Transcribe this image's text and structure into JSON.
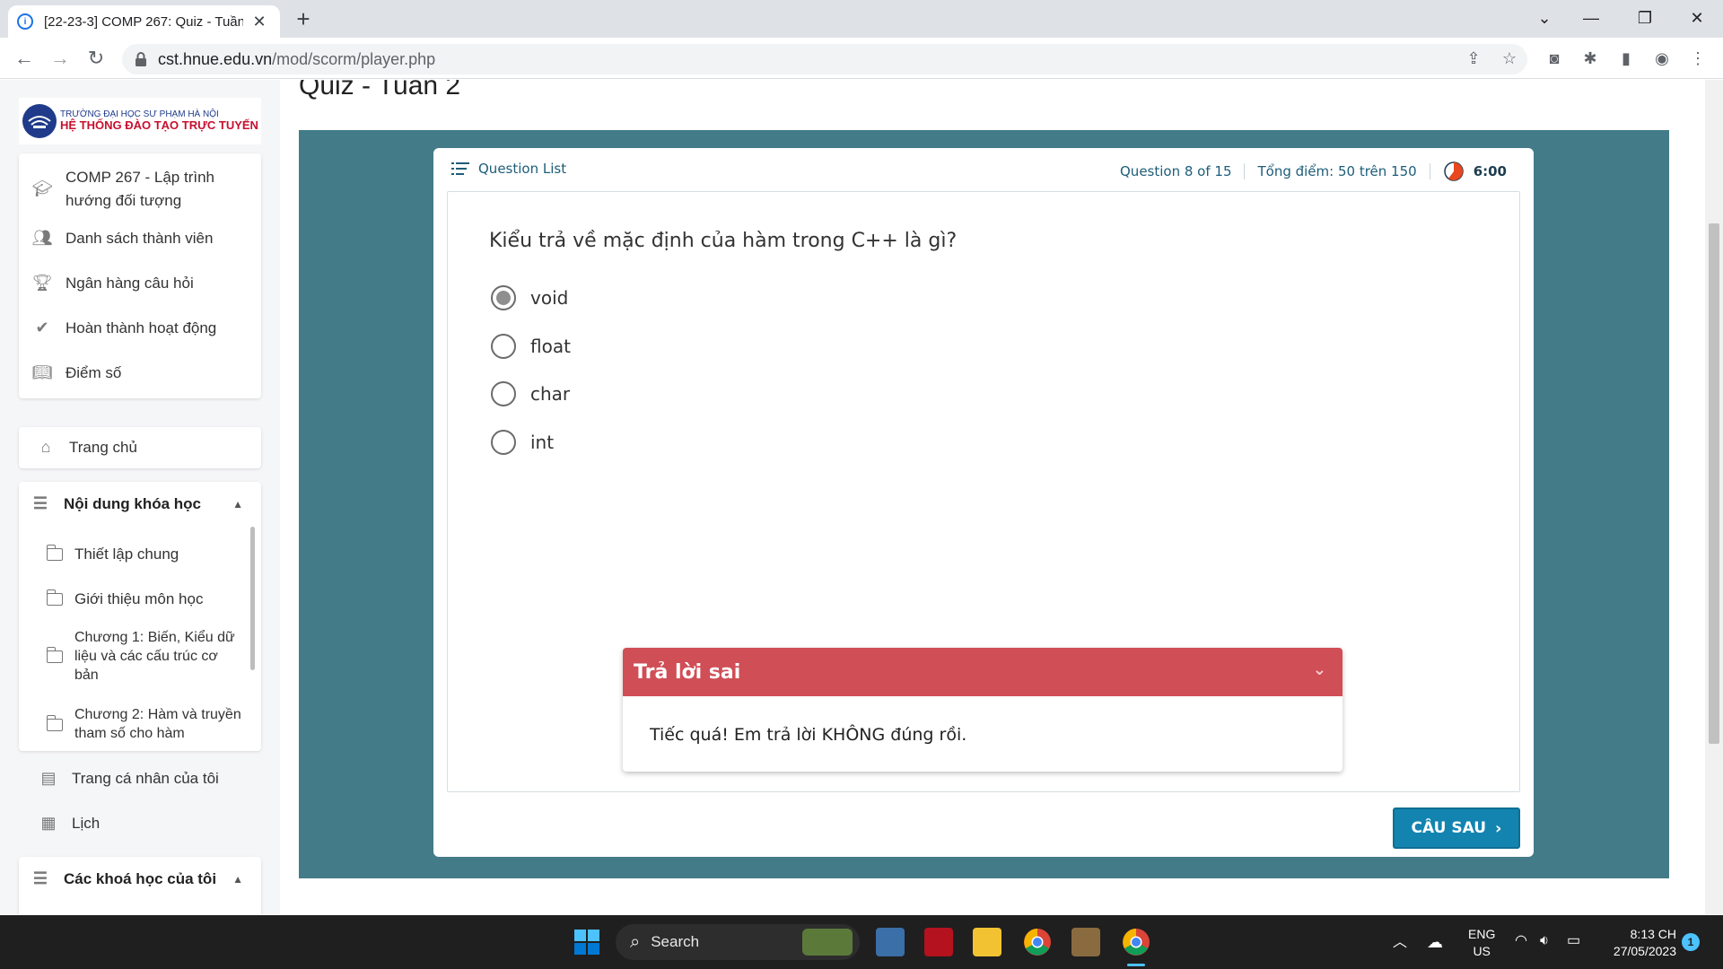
{
  "browser": {
    "tab_title": "[22-23-3] COMP 267: Quiz - Tuần 2",
    "url_host": "cst.hnue.edu.vn",
    "url_path": "/mod/scorm/player.php"
  },
  "sidebar": {
    "logo_line1": "TRƯỜNG ĐẠI HỌC SƯ PHẠM HÀ NỘI",
    "logo_line2": "HỆ THỐNG ĐÀO TẠO TRỰC TUYẾN",
    "course_menu": [
      {
        "label": "COMP 267 - Lập trình hướng đối tượng",
        "icon": "graduation-cap-icon"
      },
      {
        "label": "Danh sách thành viên",
        "icon": "users-icon"
      },
      {
        "label": "Ngân hàng câu hỏi",
        "icon": "trophy-icon"
      },
      {
        "label": "Hoàn thành hoạt động",
        "icon": "check-icon"
      },
      {
        "label": "Điểm số",
        "icon": "book-icon"
      }
    ],
    "home": "Trang chủ",
    "course_content_header": "Nội dung khóa học",
    "course_sections": [
      "Thiết lập chung",
      "Giới thiệu môn học",
      "Chương 1: Biến, Kiểu dữ liệu và các cấu trúc cơ bản",
      "Chương 2: Hàm và truyền tham số cho hàm"
    ],
    "profile": "Trang cá nhân của tôi",
    "calendar": "Lịch",
    "my_courses_header": "Các khoá học của tôi"
  },
  "page": {
    "title": "Quiz - Tuần 2"
  },
  "quiz": {
    "question_list": "Question List",
    "progress": "Question 8 of 15",
    "score": "Tổng điểm: 50 trên 150",
    "timer": "6:00",
    "question": "Kiểu trả về mặc định của hàm trong C++ là gì?",
    "options": [
      "void",
      "float",
      "char",
      "int"
    ],
    "selected_option": "void",
    "feedback_title": "Trả lời sai",
    "feedback_text": "Tiếc quá! Em trả lời KHÔNG đúng rồi.",
    "next_button": "CÂU SAU",
    "accent_color": "#1d5d79",
    "frame_color": "#437b88",
    "wrong_color": "#d04e56"
  },
  "taskbar": {
    "search": "Search",
    "lang_line1": "ENG",
    "lang_line2": "US",
    "time": "8:13 CH",
    "date": "27/05/2023",
    "notification_count": "1"
  }
}
